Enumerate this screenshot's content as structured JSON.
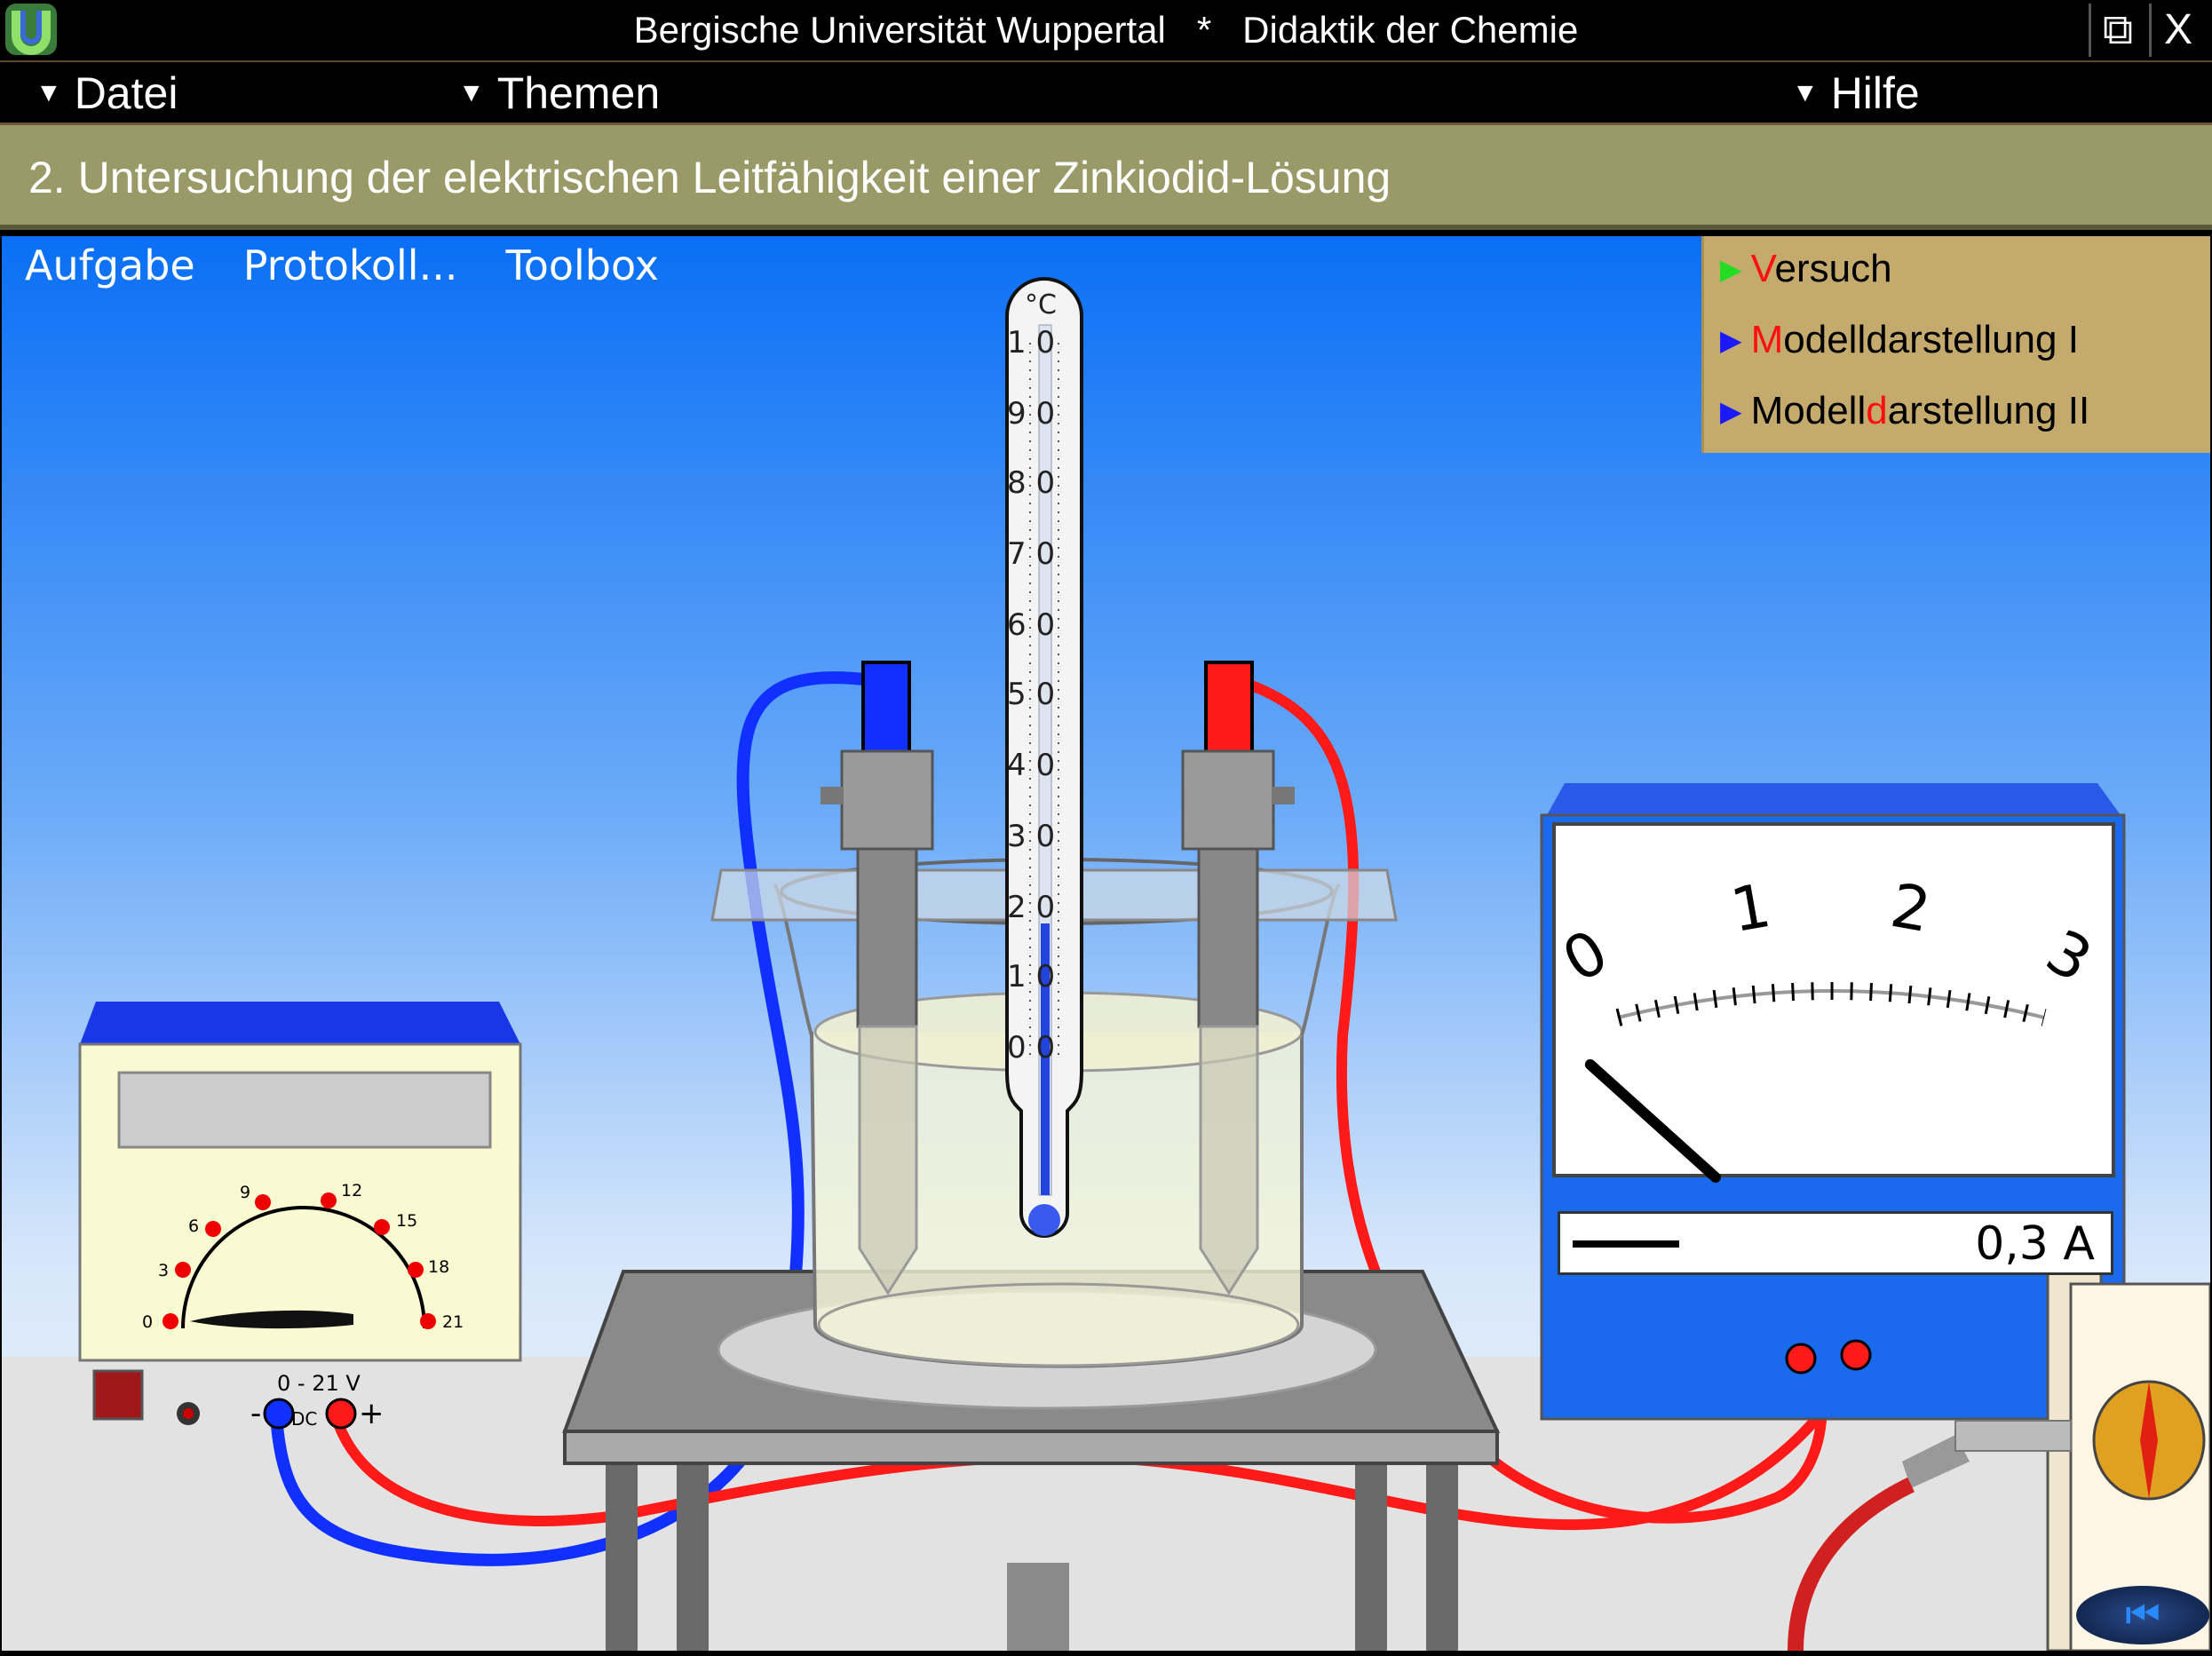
{
  "window": {
    "title": "Bergische Universität Wuppertal   *   Didaktik der Chemie",
    "restore_label": "⧉",
    "close_label": "X"
  },
  "menu": {
    "file": "Datei",
    "topics": "Themen",
    "help": "Hilfe"
  },
  "topic": {
    "title": "2. Untersuchung der elektrischen Leitfähigkeit einer Zinkiodid-Lösung"
  },
  "tabs": [
    "Aufgabe",
    "Protokoll...",
    "Toolbox"
  ],
  "views": [
    {
      "first": "V",
      "rest": "ersuch",
      "active": true
    },
    {
      "first": "M",
      "rest": "odelldarstellung I",
      "active": false
    },
    {
      "pre": "Modell",
      "hl": "d",
      "post": "arstellung II",
      "active": false
    }
  ],
  "thermometer": {
    "unit": "°C",
    "labels": [
      "1 0",
      "9 0",
      "8 0",
      "7 0",
      "6 0",
      "5 0",
      "4 0",
      "3 0",
      "2 0",
      "1 0",
      "0 0"
    ]
  },
  "power_supply": {
    "range": "0 - 21 V",
    "mode": "DC",
    "minus": "-",
    "plus": "+",
    "dial": [
      "0",
      "3",
      "6",
      "9",
      "12",
      "15",
      "18",
      "21"
    ]
  },
  "ammeter": {
    "scale": [
      "0",
      "1",
      "2",
      "3"
    ],
    "value": "0,3 A",
    "needle_value": 0.3,
    "scale_max": 3
  },
  "nav": {
    "back": "⏮"
  },
  "colors": {
    "stage_top": "#0a6ff5",
    "negative_cable": "#1030ff",
    "positive_cable": "#ff1a1a",
    "view_panel": "#c4aa6c",
    "topic_bar": "#9a9a68"
  }
}
